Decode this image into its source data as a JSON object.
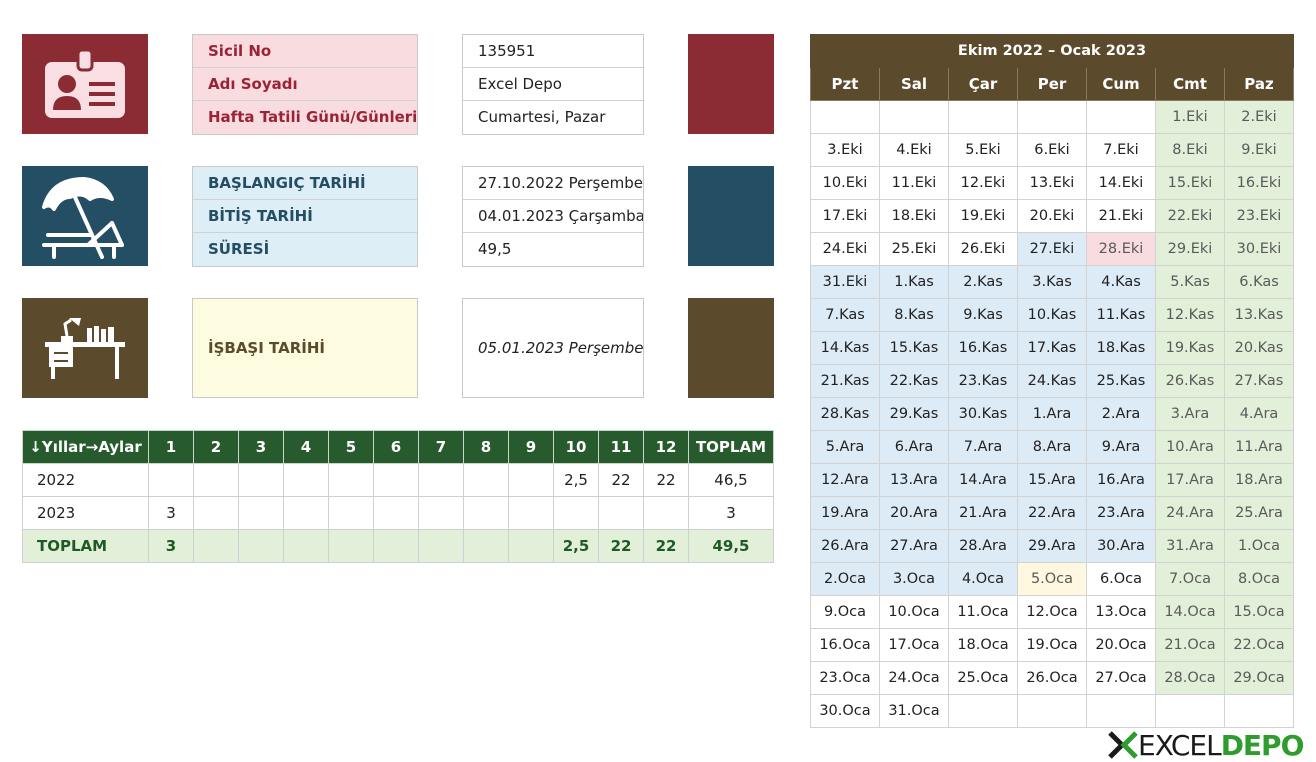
{
  "info": {
    "personal": {
      "labels": [
        "Sicil No",
        "Adı Soyadı",
        "Hafta Tatili Günü/Günleri"
      ],
      "values": [
        "135951",
        "Excel Depo",
        "Cumartesi, Pazar"
      ]
    },
    "leave": {
      "labels": [
        "BAŞLANGIÇ TARİHİ",
        "BİTİŞ TARİHİ",
        "SÜRESİ"
      ],
      "values": [
        "27.10.2022 Perşembe",
        "04.01.2023 Çarşamba",
        "49,5"
      ]
    },
    "return": {
      "label": "İŞBAŞI TARİHİ",
      "value": "05.01.2023 Perşembe"
    }
  },
  "colors": {
    "personal": "#8b2c35",
    "leave": "#234e63",
    "return": "#5c4a2c",
    "personal_bg": "#f8dce0",
    "personal_fg": "#9b2335",
    "leave_bg": "#ddeef7",
    "leave_fg": "#234e63",
    "return_bg": "#fdfbe0",
    "return_fg": "#5c4a2c",
    "weekend": "#e2f0d9",
    "vacation": "#ddebf7",
    "holiday": "#f8dce0",
    "return_day": "#fff8e0",
    "table_header": "#275a2c",
    "table_total": "#e2f0d9"
  },
  "icons": {
    "personal": "id-card-icon",
    "leave": "beach-umbrella-icon",
    "return": "desk-lamp-icon"
  },
  "summary": {
    "header": [
      "↓Yıllar→Aylar",
      "1",
      "2",
      "3",
      "4",
      "5",
      "6",
      "7",
      "8",
      "9",
      "10",
      "11",
      "12",
      "TOPLAM"
    ],
    "rows": [
      [
        "2022",
        "",
        "",
        "",
        "",
        "",
        "",
        "",
        "",
        "",
        "2,5",
        "22",
        "22",
        "46,5"
      ],
      [
        "2023",
        "3",
        "",
        "",
        "",
        "",
        "",
        "",
        "",
        "",
        "",
        "",
        "",
        "3"
      ]
    ],
    "total": [
      "TOPLAM",
      "3",
      "",
      "",
      "",
      "",
      "",
      "",
      "",
      "",
      "2,5",
      "22",
      "22",
      "49,5"
    ]
  },
  "calendar": {
    "title": "Ekim  2022 – Ocak  2023",
    "days": [
      "Pzt",
      "Sal",
      "Çar",
      "Per",
      "Cum",
      "Cmt",
      "Paz"
    ],
    "weeks": [
      [
        {
          "t": ""
        },
        {
          "t": ""
        },
        {
          "t": ""
        },
        {
          "t": ""
        },
        {
          "t": ""
        },
        {
          "t": "1.Eki",
          "s": "weekend"
        },
        {
          "t": "2.Eki",
          "s": "weekend"
        }
      ],
      [
        {
          "t": "3.Eki"
        },
        {
          "t": "4.Eki"
        },
        {
          "t": "5.Eki"
        },
        {
          "t": "6.Eki"
        },
        {
          "t": "7.Eki"
        },
        {
          "t": "8.Eki",
          "s": "weekend"
        },
        {
          "t": "9.Eki",
          "s": "weekend"
        }
      ],
      [
        {
          "t": "10.Eki"
        },
        {
          "t": "11.Eki"
        },
        {
          "t": "12.Eki"
        },
        {
          "t": "13.Eki"
        },
        {
          "t": "14.Eki"
        },
        {
          "t": "15.Eki",
          "s": "weekend"
        },
        {
          "t": "16.Eki",
          "s": "weekend"
        }
      ],
      [
        {
          "t": "17.Eki"
        },
        {
          "t": "18.Eki"
        },
        {
          "t": "19.Eki"
        },
        {
          "t": "20.Eki"
        },
        {
          "t": "21.Eki"
        },
        {
          "t": "22.Eki",
          "s": "weekend"
        },
        {
          "t": "23.Eki",
          "s": "weekend"
        }
      ],
      [
        {
          "t": "24.Eki"
        },
        {
          "t": "25.Eki"
        },
        {
          "t": "26.Eki"
        },
        {
          "t": "27.Eki",
          "s": "start"
        },
        {
          "t": "28.Eki",
          "s": "holiday"
        },
        {
          "t": "29.Eki",
          "s": "weekend"
        },
        {
          "t": "30.Eki",
          "s": "weekend"
        }
      ],
      [
        {
          "t": "31.Eki",
          "s": "vacation"
        },
        {
          "t": "1.Kas",
          "s": "vacation"
        },
        {
          "t": "2.Kas",
          "s": "vacation"
        },
        {
          "t": "3.Kas",
          "s": "vacation"
        },
        {
          "t": "4.Kas",
          "s": "vacation"
        },
        {
          "t": "5.Kas",
          "s": "weekend"
        },
        {
          "t": "6.Kas",
          "s": "weekend"
        }
      ],
      [
        {
          "t": "7.Kas",
          "s": "vacation"
        },
        {
          "t": "8.Kas",
          "s": "vacation"
        },
        {
          "t": "9.Kas",
          "s": "vacation"
        },
        {
          "t": "10.Kas",
          "s": "vacation"
        },
        {
          "t": "11.Kas",
          "s": "vacation"
        },
        {
          "t": "12.Kas",
          "s": "weekend"
        },
        {
          "t": "13.Kas",
          "s": "weekend"
        }
      ],
      [
        {
          "t": "14.Kas",
          "s": "vacation"
        },
        {
          "t": "15.Kas",
          "s": "vacation"
        },
        {
          "t": "16.Kas",
          "s": "vacation"
        },
        {
          "t": "17.Kas",
          "s": "vacation"
        },
        {
          "t": "18.Kas",
          "s": "vacation"
        },
        {
          "t": "19.Kas",
          "s": "weekend"
        },
        {
          "t": "20.Kas",
          "s": "weekend"
        }
      ],
      [
        {
          "t": "21.Kas",
          "s": "vacation"
        },
        {
          "t": "22.Kas",
          "s": "vacation"
        },
        {
          "t": "23.Kas",
          "s": "vacation"
        },
        {
          "t": "24.Kas",
          "s": "vacation"
        },
        {
          "t": "25.Kas",
          "s": "vacation"
        },
        {
          "t": "26.Kas",
          "s": "weekend"
        },
        {
          "t": "27.Kas",
          "s": "weekend"
        }
      ],
      [
        {
          "t": "28.Kas",
          "s": "vacation"
        },
        {
          "t": "29.Kas",
          "s": "vacation"
        },
        {
          "t": "30.Kas",
          "s": "vacation"
        },
        {
          "t": "1.Ara",
          "s": "vacation"
        },
        {
          "t": "2.Ara",
          "s": "vacation"
        },
        {
          "t": "3.Ara",
          "s": "weekend"
        },
        {
          "t": "4.Ara",
          "s": "weekend"
        }
      ],
      [
        {
          "t": "5.Ara",
          "s": "vacation"
        },
        {
          "t": "6.Ara",
          "s": "vacation"
        },
        {
          "t": "7.Ara",
          "s": "vacation"
        },
        {
          "t": "8.Ara",
          "s": "vacation"
        },
        {
          "t": "9.Ara",
          "s": "vacation"
        },
        {
          "t": "10.Ara",
          "s": "weekend"
        },
        {
          "t": "11.Ara",
          "s": "weekend"
        }
      ],
      [
        {
          "t": "12.Ara",
          "s": "vacation"
        },
        {
          "t": "13.Ara",
          "s": "vacation"
        },
        {
          "t": "14.Ara",
          "s": "vacation"
        },
        {
          "t": "15.Ara",
          "s": "vacation"
        },
        {
          "t": "16.Ara",
          "s": "vacation"
        },
        {
          "t": "17.Ara",
          "s": "weekend"
        },
        {
          "t": "18.Ara",
          "s": "weekend"
        }
      ],
      [
        {
          "t": "19.Ara",
          "s": "vacation"
        },
        {
          "t": "20.Ara",
          "s": "vacation"
        },
        {
          "t": "21.Ara",
          "s": "vacation"
        },
        {
          "t": "22.Ara",
          "s": "vacation"
        },
        {
          "t": "23.Ara",
          "s": "vacation"
        },
        {
          "t": "24.Ara",
          "s": "weekend"
        },
        {
          "t": "25.Ara",
          "s": "weekend"
        }
      ],
      [
        {
          "t": "26.Ara",
          "s": "vacation"
        },
        {
          "t": "27.Ara",
          "s": "vacation"
        },
        {
          "t": "28.Ara",
          "s": "vacation"
        },
        {
          "t": "29.Ara",
          "s": "vacation"
        },
        {
          "t": "30.Ara",
          "s": "vacation"
        },
        {
          "t": "31.Ara",
          "s": "weekend"
        },
        {
          "t": "1.Oca",
          "s": "weekend"
        }
      ],
      [
        {
          "t": "2.Oca",
          "s": "vacation"
        },
        {
          "t": "3.Oca",
          "s": "vacation"
        },
        {
          "t": "4.Oca",
          "s": "vacation"
        },
        {
          "t": "5.Oca",
          "s": "return"
        },
        {
          "t": "6.Oca"
        },
        {
          "t": "7.Oca",
          "s": "weekend"
        },
        {
          "t": "8.Oca",
          "s": "weekend"
        }
      ],
      [
        {
          "t": "9.Oca"
        },
        {
          "t": "10.Oca"
        },
        {
          "t": "11.Oca"
        },
        {
          "t": "12.Oca"
        },
        {
          "t": "13.Oca"
        },
        {
          "t": "14.Oca",
          "s": "weekend"
        },
        {
          "t": "15.Oca",
          "s": "weekend"
        }
      ],
      [
        {
          "t": "16.Oca"
        },
        {
          "t": "17.Oca"
        },
        {
          "t": "18.Oca"
        },
        {
          "t": "19.Oca"
        },
        {
          "t": "20.Oca"
        },
        {
          "t": "21.Oca",
          "s": "weekend"
        },
        {
          "t": "22.Oca",
          "s": "weekend"
        }
      ],
      [
        {
          "t": "23.Oca"
        },
        {
          "t": "24.Oca"
        },
        {
          "t": "25.Oca"
        },
        {
          "t": "26.Oca"
        },
        {
          "t": "27.Oca"
        },
        {
          "t": "28.Oca",
          "s": "weekend"
        },
        {
          "t": "29.Oca",
          "s": "weekend"
        }
      ],
      [
        {
          "t": "30.Oca"
        },
        {
          "t": "31.Oca"
        },
        {
          "t": ""
        },
        {
          "t": ""
        },
        {
          "t": ""
        },
        {
          "t": ""
        },
        {
          "t": ""
        }
      ]
    ]
  },
  "logo": {
    "part1": "EXCEL",
    "part2": "DEPO",
    "color1": "#1a1a1a",
    "color2": "#2e9d2e"
  }
}
